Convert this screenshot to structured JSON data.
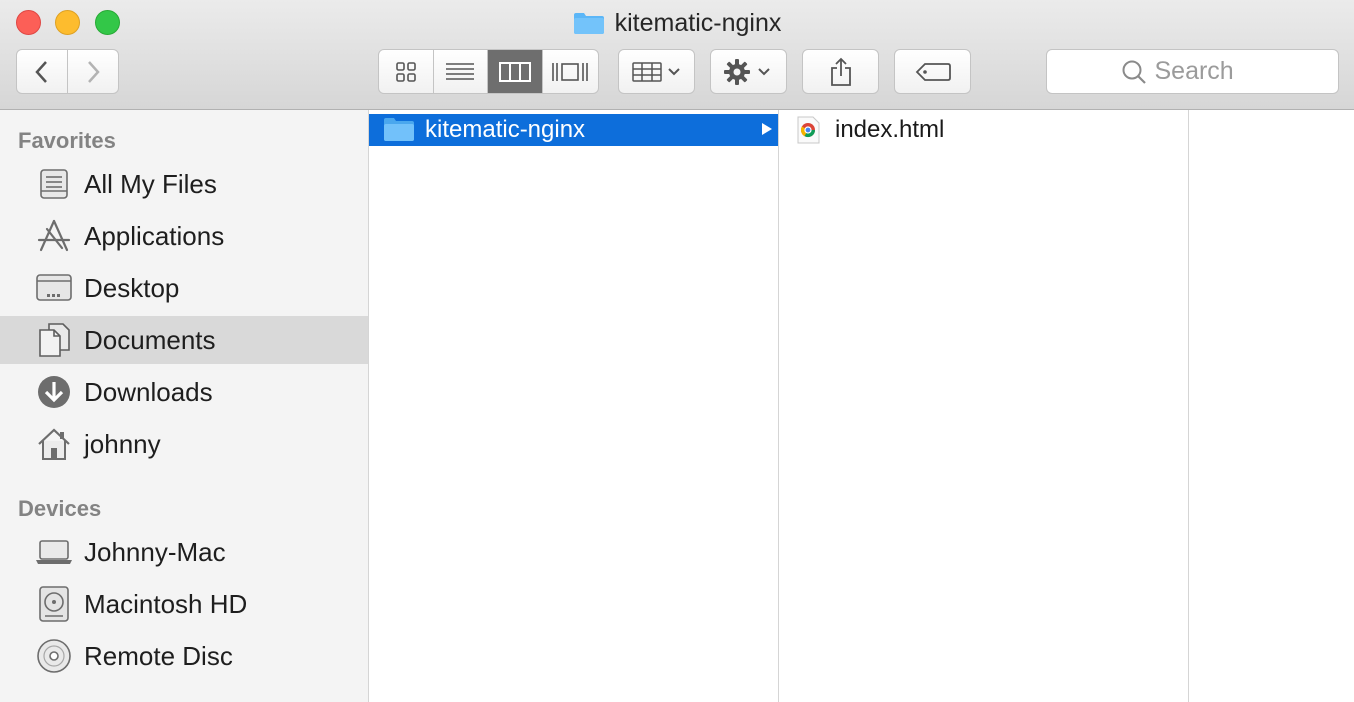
{
  "window": {
    "title": "kitematic-nginx"
  },
  "toolbar": {
    "back": "chevron-left-icon",
    "forward": "chevron-right-icon",
    "view_modes": [
      "icon-view-icon",
      "list-view-icon",
      "column-view-icon",
      "cover-flow-icon"
    ],
    "active_view": "column-view-icon",
    "arrange": "arrange-grid-icon",
    "action": "gear-icon",
    "share": "share-icon",
    "tag": "tag-icon",
    "search_placeholder": "Search"
  },
  "sidebar": {
    "favorites_title": "Favorites",
    "favorites": [
      {
        "label": "All My Files",
        "icon": "all-my-files-icon"
      },
      {
        "label": "Applications",
        "icon": "applications-icon"
      },
      {
        "label": "Desktop",
        "icon": "desktop-icon"
      },
      {
        "label": "Documents",
        "icon": "documents-icon",
        "selected": true
      },
      {
        "label": "Downloads",
        "icon": "downloads-icon"
      },
      {
        "label": "johnny",
        "icon": "home-icon"
      }
    ],
    "devices_title": "Devices",
    "devices": [
      {
        "label": "Johnny-Mac",
        "icon": "laptop-icon"
      },
      {
        "label": "Macintosh HD",
        "icon": "hard-drive-icon"
      },
      {
        "label": "Remote Disc",
        "icon": "disc-icon"
      }
    ]
  },
  "columns": {
    "col1": [
      {
        "label": "kitematic-nginx",
        "icon": "folder-icon",
        "selected": true
      }
    ],
    "col2": [
      {
        "label": "index.html",
        "icon": "chrome-html-icon"
      }
    ]
  },
  "colors": {
    "selection": "#0d6edb",
    "folder": "#5bb6f7"
  }
}
